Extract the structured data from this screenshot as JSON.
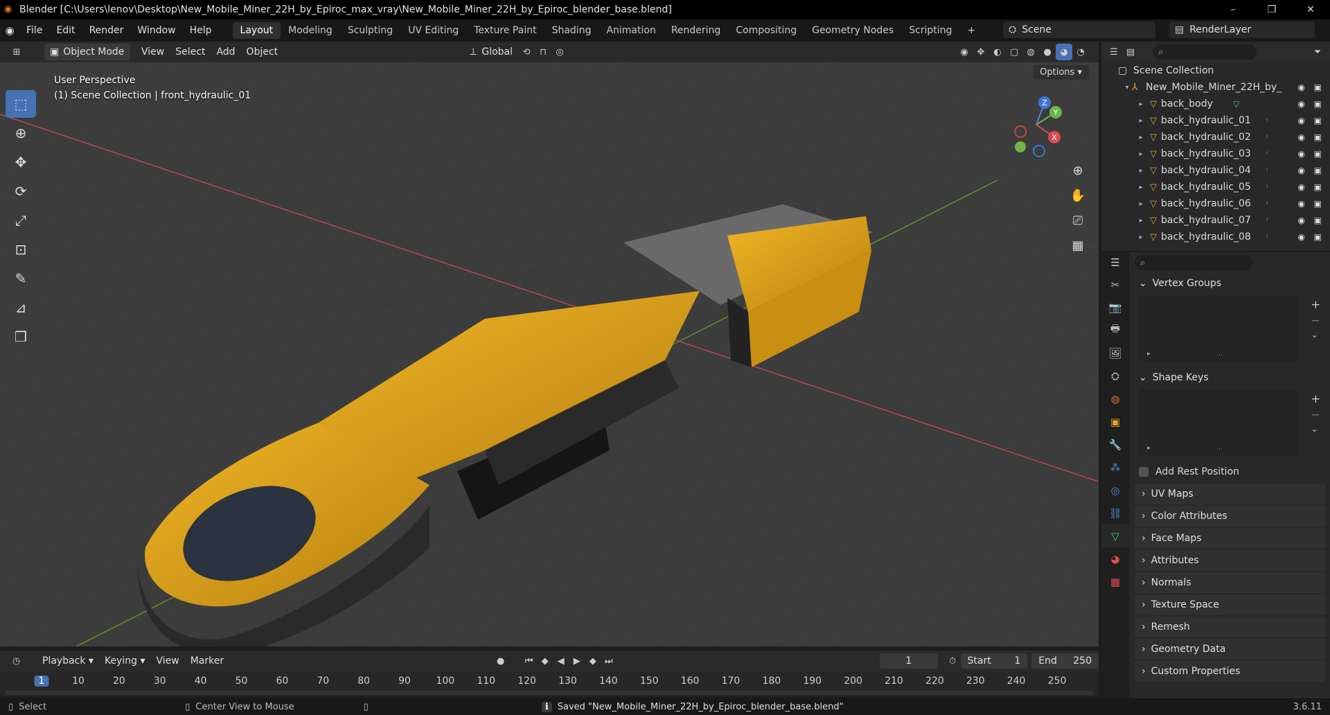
{
  "titlebar": {
    "title": "Blender [C:\\Users\\lenov\\Desktop\\New_Mobile_Miner_22H_by_Epiroc_max_vray\\New_Mobile_Miner_22H_by_Epiroc_blender_base.blend]",
    "minimize": "–",
    "maximize": "❐",
    "close": "✕"
  },
  "menu": [
    "File",
    "Edit",
    "Render",
    "Window",
    "Help"
  ],
  "workspaces": [
    "Layout",
    "Modeling",
    "Sculpting",
    "UV Editing",
    "Texture Paint",
    "Shading",
    "Animation",
    "Rendering",
    "Compositing",
    "Geometry Nodes",
    "Scripting"
  ],
  "workspace_add": "+",
  "scene": {
    "label": "Scene",
    "view_layer": "RenderLayer"
  },
  "viewport_header": {
    "mode": "Object Mode",
    "view": "View",
    "select": "Select",
    "add": "Add",
    "object": "Object",
    "orientation": "Global"
  },
  "viewport": {
    "perspective": "User Perspective",
    "collection_line": "(1) Scene Collection | front_hydraulic_01",
    "options": "Options"
  },
  "gizmo": {
    "z": "Z",
    "y": "Y",
    "x": "X"
  },
  "outliner": {
    "root": "Scene Collection",
    "collection": "New_Mobile_Miner_22H_by_",
    "items": [
      "back_body",
      "back_hydraulic_01",
      "back_hydraulic_02",
      "back_hydraulic_03",
      "back_hydraulic_04",
      "back_hydraulic_05",
      "back_hydraulic_06",
      "back_hydraulic_07",
      "back_hydraulic_08"
    ]
  },
  "properties": {
    "vertex_groups": "Vertex Groups",
    "shape_keys": "Shape Keys",
    "add_rest_position": "Add Rest Position",
    "panels": [
      "UV Maps",
      "Color Attributes",
      "Face Maps",
      "Attributes",
      "Normals",
      "Texture Space",
      "Remesh",
      "Geometry Data",
      "Custom Properties"
    ]
  },
  "timeline": {
    "playback": "Playback",
    "keying": "Keying",
    "view": "View",
    "marker": "Marker",
    "current_frame": "1",
    "start_label": "Start",
    "start": "1",
    "end_label": "End",
    "end": "250",
    "ticks": [
      "1",
      "10",
      "20",
      "30",
      "40",
      "50",
      "60",
      "70",
      "80",
      "90",
      "100",
      "110",
      "120",
      "130",
      "140",
      "150",
      "160",
      "170",
      "180",
      "190",
      "200",
      "210",
      "220",
      "230",
      "240",
      "250"
    ]
  },
  "statusbar": {
    "select": "Select",
    "center_view": "Center View to Mouse",
    "message": "Saved \"New_Mobile_Miner_22H_by_Epiroc_blender_base.blend\"",
    "version": "3.6.11"
  },
  "colors": {
    "accent": "#4772b3",
    "object_orange": "#e8a035",
    "machine_yellow": "#e0a818"
  }
}
